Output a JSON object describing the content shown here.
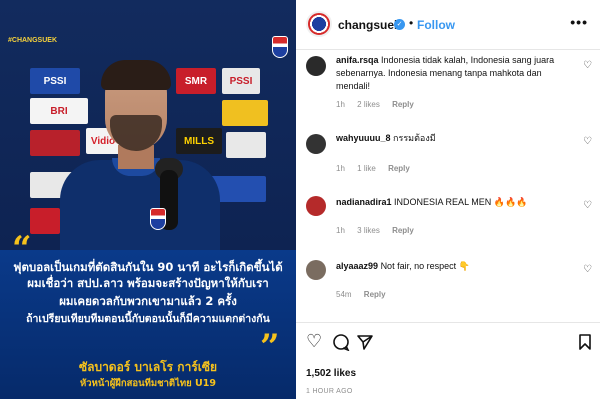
{
  "media": {
    "brand": "#CHANGSUEK",
    "board_labels": [
      "PSSI",
      "SMR",
      "Vidio",
      "MILLS",
      "PSSI",
      "BRI"
    ],
    "quote_lines": [
      "ฟุตบอลเป็นเกมที่ตัดสินกันใน 90 นาที อะไรก็เกิดขึ้นได้",
      "ผมเชื่อว่า สปป.ลาว พร้อมจะสร้างปัญหาให้กับเรา",
      "ผมเคยดวลกับพวกเขามาแล้ว 2 ครั้ง",
      "ถ้าเปรียบเทียบทีมตอนนี้กับตอนนั้นก็มีความแตกต่างกัน"
    ],
    "author_name": "ซัลบาดอร์ บาเลโร การ์เซีย",
    "author_title": "หัวหน้าผู้ฝึกสอนทีมชาติไทย U19",
    "colors": {
      "accent": "#f6c21c",
      "navy": "#0a3a8a"
    }
  },
  "header": {
    "username": "changsuek",
    "verified_icon": "verified-badge-icon",
    "separator": "•",
    "follow_label": "Follow",
    "more_label": "•••"
  },
  "comments": [
    {
      "username": "anifa.rsqa",
      "text": "Indonesia tidak kalah, Indonesia sang juara sebenarnya. Indonesia menang tanpa mahkota dan mendali!",
      "time": "1h",
      "likes": "2 likes",
      "reply": "Reply"
    },
    {
      "username": "wahyuuuu_8",
      "text": "กรรมต้องมี",
      "time": "1h",
      "likes": "1 like",
      "reply": "Reply"
    },
    {
      "username": "nadianadira1",
      "text": "INDONESIA REAL MEN 🔥🔥🔥",
      "time": "1h",
      "likes": "3 likes",
      "reply": "Reply"
    },
    {
      "username": "alyaaaz99",
      "text": "Not fair, no respect 👇",
      "time": "54m",
      "reply": "Reply"
    }
  ],
  "actions": {
    "like_icon": "heart-icon",
    "comment_icon": "comment-icon",
    "share_icon": "send-icon",
    "save_icon": "bookmark-icon"
  },
  "post": {
    "likes": "1,502 likes",
    "posted": "1 HOUR AGO"
  }
}
